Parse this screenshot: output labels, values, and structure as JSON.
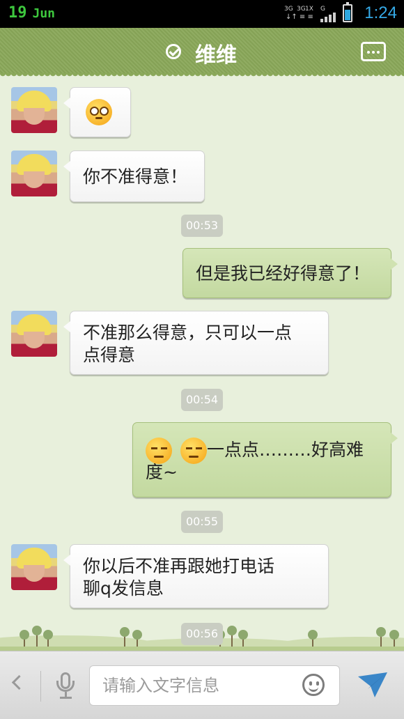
{
  "status_bar": {
    "day": "19",
    "month": "Jun",
    "network_labels": [
      "3G",
      "3G",
      "1X",
      "G"
    ],
    "time": "1:24",
    "battery_level": 0.7,
    "accent_color": "#35a9e6"
  },
  "header": {
    "title": "维维",
    "verified_icon": "check-circle-icon",
    "menu_icon": "more-options-icon",
    "color": "#8aa85a"
  },
  "messages": [
    {
      "side": "left",
      "type": "emoji",
      "emoji": "confused-face"
    },
    {
      "side": "left",
      "type": "text",
      "text": "你不准得意！"
    },
    {
      "type": "time",
      "text": "00:53"
    },
    {
      "side": "right",
      "type": "text",
      "text": "但是我已经好得意了！"
    },
    {
      "side": "left",
      "type": "text",
      "lines": [
        "不准那么得意，只可以一点",
        "点得意"
      ]
    },
    {
      "type": "time",
      "text": "00:54"
    },
    {
      "side": "right",
      "type": "emoji-text",
      "emoji": "smug-face",
      "emoji_count": 2,
      "lines": [
        "一点点………好高难",
        "度~"
      ]
    },
    {
      "type": "time",
      "text": "00:55"
    },
    {
      "side": "left",
      "type": "text",
      "lines": [
        "你以后不准再跟她打电话",
        "聊q发信息"
      ]
    },
    {
      "type": "time",
      "text": "00:56"
    }
  ],
  "input_bar": {
    "placeholder": "请输入文字信息",
    "back_icon": "back-arrow-icon",
    "voice_icon": "microphone-icon",
    "emoji_icon": "smiley-icon",
    "send_icon": "send-icon",
    "send_color": "#3a86c8"
  }
}
